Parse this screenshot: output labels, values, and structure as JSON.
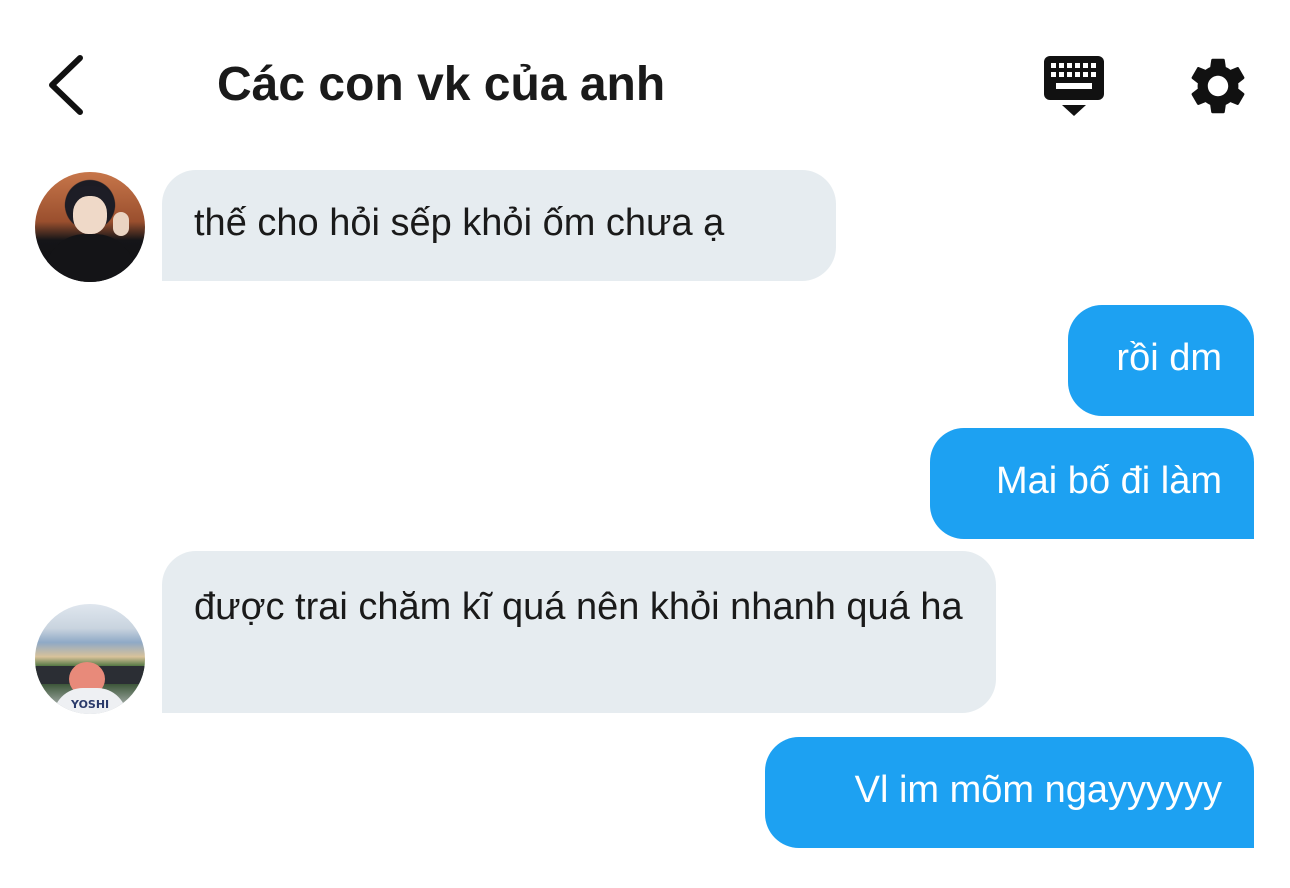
{
  "header": {
    "back_icon": "chevron-left-icon",
    "title": "Các con vk của anh",
    "keyboard_icon": "keyboard-icon",
    "settings_icon": "gear-icon"
  },
  "messages": [
    {
      "direction": "incoming",
      "text": "thế cho hỏi sếp khỏi ốm chưa ạ"
    },
    {
      "direction": "outgoing",
      "text": "rồi dm"
    },
    {
      "direction": "outgoing",
      "text": "Mai bố đi làm"
    },
    {
      "direction": "incoming",
      "text": "được trai chăm kĩ quá nên khỏi nhanh quá ha"
    },
    {
      "direction": "outgoing",
      "text": "Vl im mõm ngayyyyyy"
    }
  ],
  "avatars": {
    "second_shirt_text": "YOSHI"
  },
  "colors": {
    "outgoing_bubble": "#1da1f2",
    "incoming_bubble": "#e6ecf0",
    "text_dark": "#1a1a1a"
  }
}
